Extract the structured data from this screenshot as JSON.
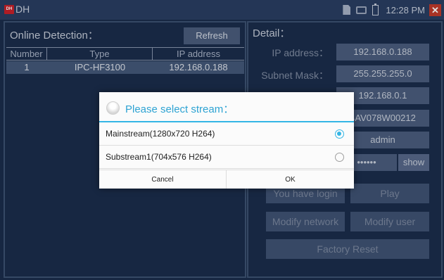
{
  "status_bar": {
    "app_logo": "DH",
    "app_title": "DH",
    "clock": "12:28 PM",
    "icons": [
      "sd-card-icon",
      "network-icon",
      "battery-icon",
      "close-icon"
    ],
    "close_glyph": "✕"
  },
  "online_detection": {
    "title": "Online Detection：",
    "refresh_label": "Refresh",
    "columns": [
      "Number",
      "Type",
      "IP address"
    ],
    "rows": [
      {
        "number": "1",
        "type": "IPC-HF3100",
        "ip": "192.168.0.188"
      }
    ]
  },
  "detail": {
    "title": "Detail：",
    "ip_label": "IP address：",
    "ip_value": "192.168.0.188",
    "mask_label": "Subnet Mask：",
    "mask_value": "255.255.255.0",
    "gateway_value": "192.168.0.1",
    "serial_value": "4AV078W00212",
    "user_value": "admin",
    "password_value": "••••••",
    "show_label": "show",
    "login_status": "You have login",
    "play_label": "Play",
    "modify_network_label": "Modify network",
    "modify_user_label": "Modify user",
    "factory_reset_label": "Factory Reset"
  },
  "dialog": {
    "title": "Please select stream：",
    "options": [
      {
        "label": "Mainstream(1280x720 H264)",
        "selected": true
      },
      {
        "label": "Substream1(704x576 H264)",
        "selected": false
      }
    ],
    "cancel_label": "Cancel",
    "ok_label": "OK"
  },
  "colors": {
    "background": "#1b2d4c",
    "accent": "#33b5e5",
    "close_red": "#c0392b"
  }
}
